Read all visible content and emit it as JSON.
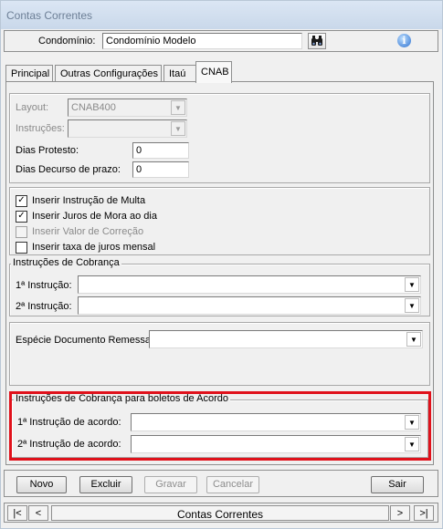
{
  "window": {
    "title": "Contas Correntes"
  },
  "header": {
    "condominio_label": "Condomínio:",
    "condominio_value": "Condomínio Modelo",
    "search_icon": "binoculars-icon",
    "info_icon": "info-icon"
  },
  "tabs": [
    {
      "label": "Principal",
      "active": false
    },
    {
      "label": "Outras Configurações",
      "active": false
    },
    {
      "label": "Itaú",
      "active": false
    },
    {
      "label": "CNAB",
      "active": true
    }
  ],
  "cnab": {
    "layout_label": "Layout:",
    "layout_value": "CNAB400",
    "instrucoes_label": "Instruções:",
    "instrucoes_value": "",
    "dias_protesto_label": "Dias Protesto:",
    "dias_protesto_value": "0",
    "dias_decurso_label": "Dias Decurso de prazo:",
    "dias_decurso_value": "0"
  },
  "options": [
    {
      "label": "Inserir Instrução de Multa",
      "checked": true,
      "enabled": true
    },
    {
      "label": "Inserir Juros de Mora ao dia",
      "checked": true,
      "enabled": true
    },
    {
      "label": "Inserir Valor de Correção",
      "checked": false,
      "enabled": false
    },
    {
      "label": "Inserir taxa de juros mensal",
      "checked": false,
      "enabled": true
    }
  ],
  "cobranca": {
    "title": "Instruções de Cobrança",
    "instr1_label": "1ª Instrução:",
    "instr1_value": "",
    "instr2_label": "2ª Instrução:",
    "instr2_value": ""
  },
  "remessa": {
    "label": "Espécie Documento Remessa:",
    "value": ""
  },
  "acordo": {
    "title": "Instruções de Cobrança para boletos de Acordo",
    "instr1_label": "1ª Instrução de acordo:",
    "instr1_value": "",
    "instr2_label": "2ª Instrução de acordo:",
    "instr2_value": ""
  },
  "buttons": {
    "novo": "Novo",
    "excluir": "Excluir",
    "gravar": "Gravar",
    "cancelar": "Cancelar",
    "sair": "Sair"
  },
  "navigator": {
    "first": "|<",
    "prev": "<",
    "title": "Contas Correntes",
    "next": ">",
    "last": ">|"
  },
  "colors": {
    "highlight": "#e0111b",
    "titlebar_text": "#6d7f96"
  }
}
